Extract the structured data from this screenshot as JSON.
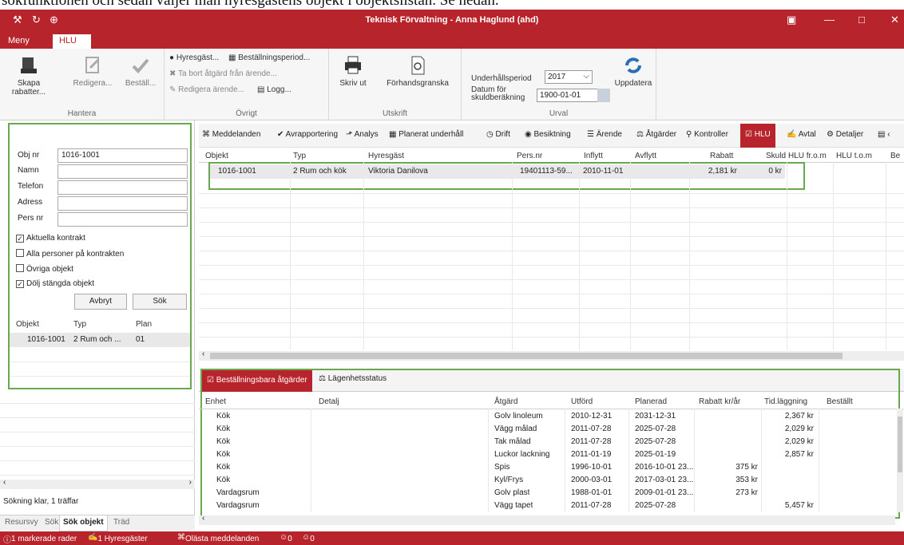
{
  "doc_text": "sökfunktionen och sedan väljer man hyresgästens objekt i objektslistan. Se nedan.",
  "window": {
    "title": "Teknisk Förvaltning - Anna Haglund (ahd)"
  },
  "ribbon_tabs": [
    "Meny",
    "HLU"
  ],
  "ribbon": {
    "hantera": {
      "label": "Hantera",
      "skapa": "Skapa rabatter...",
      "redigera": "Redigera...",
      "bestall": "Beställ..."
    },
    "ovrigt": {
      "label": "Övrigt",
      "hyresgast": "Hyresgäst...",
      "bestallningsperiod": "Beställningsperiod...",
      "ta_bort": "Ta bort åtgärd från ärende...",
      "redigera_arende": "Redigera ärende...",
      "logg": "Logg..."
    },
    "utskrift": {
      "label": "Utskrift",
      "skriv_ut": "Skriv ut",
      "forhandsgranska": "Förhandsgranska"
    },
    "urval": {
      "label": "Urval",
      "underhallsperiod_label": "Underhållsperiod",
      "underhallsperiod_value": "2017",
      "datum_label": "Datum för skuldberäkning",
      "datum_value": "1900-01-01",
      "uppdatera": "Uppdatera"
    }
  },
  "search": {
    "objnr_label": "Obj nr",
    "objnr_value": "1016-1001",
    "namn_label": "Namn",
    "telefon_label": "Telefon",
    "adress_label": "Adress",
    "persnr_label": "Pers nr",
    "checkboxes": [
      {
        "label": "Aktuella kontrakt",
        "checked": "✓"
      },
      {
        "label": "Alla personer på kontrakten",
        "checked": ""
      },
      {
        "label": "Övriga objekt",
        "checked": ""
      },
      {
        "label": "Dölj stängda objekt",
        "checked": "✓"
      }
    ],
    "avbryt": "Avbryt",
    "sok": "Sök"
  },
  "object_list": {
    "headers": [
      "Objekt",
      "Typ",
      "Plan"
    ],
    "row": [
      "1016-1001",
      "2 Rum och ...",
      "01"
    ]
  },
  "left_status": "Sökning klar, 1 träffar",
  "bottom_tabs": [
    "Resursvy",
    "Sök",
    "Sök objekt",
    "Träd"
  ],
  "main_tabs": [
    "Meddelanden",
    "Avrapportering",
    "Analys",
    "Planerat underhåll",
    "Drift",
    "Besiktning",
    "Ärende",
    "Åtgärder",
    "Kontroller",
    "HLU",
    "Avtal",
    "Detaljer"
  ],
  "hlu_table": {
    "headers": [
      "Objekt",
      "Typ",
      "Hyresgäst",
      "Pers.nr",
      "Inflytt",
      "Avflytt",
      "Rabatt",
      "Skuld",
      "HLU fr.o.m",
      "HLU t.o.m",
      "Be"
    ],
    "row": [
      "1016-1001",
      "2 Rum och kök",
      "Viktoria Danilova",
      "19401113-59...",
      "2010-11-01",
      "",
      "2,181 kr",
      "0 kr",
      "",
      "",
      ""
    ]
  },
  "sub_tabs": [
    "Beställningsbara åtgärder",
    "Lägenhetsstatus"
  ],
  "actions_table": {
    "headers": [
      "Enhet",
      "Detalj",
      "Åtgärd",
      "Utförd",
      "Planerad",
      "Rabatt kr/år",
      "Tid.läggning",
      "Beställt"
    ],
    "rows": [
      [
        "Kök",
        "",
        "Golv linoleum",
        "2010-12-31",
        "2031-12-31",
        "",
        "2,367 kr",
        ""
      ],
      [
        "Kök",
        "",
        "Vägg målad",
        "2011-07-28",
        "2025-07-28",
        "",
        "2,029 kr",
        ""
      ],
      [
        "Kök",
        "",
        "Tak målad",
        "2011-07-28",
        "2025-07-28",
        "",
        "2,029 kr",
        ""
      ],
      [
        "Kök",
        "",
        "Luckor lackning",
        "2011-01-19",
        "2025-01-19",
        "",
        "2,857 kr",
        ""
      ],
      [
        "Kök",
        "",
        "Spis",
        "1996-10-01",
        "2016-10-01 23...",
        "375 kr",
        "",
        ""
      ],
      [
        "Kök",
        "",
        "Kyl/Frys",
        "2000-03-01",
        "2017-03-01 23...",
        "353 kr",
        "",
        ""
      ],
      [
        "Vardagsrum",
        "",
        "Golv plast",
        "1988-01-01",
        "2009-01-01 23...",
        "273 kr",
        "",
        ""
      ],
      [
        "Vardagsrum",
        "",
        "Vägg tapet",
        "2011-07-28",
        "2025-07-28",
        "",
        "5,457 kr",
        ""
      ]
    ]
  },
  "statusbar": {
    "markerade": "1 markerade rader",
    "hyresgaster": "1 Hyresgäster",
    "olasta": "Olästa meddelanden",
    "count1": "0",
    "count2": "0"
  }
}
